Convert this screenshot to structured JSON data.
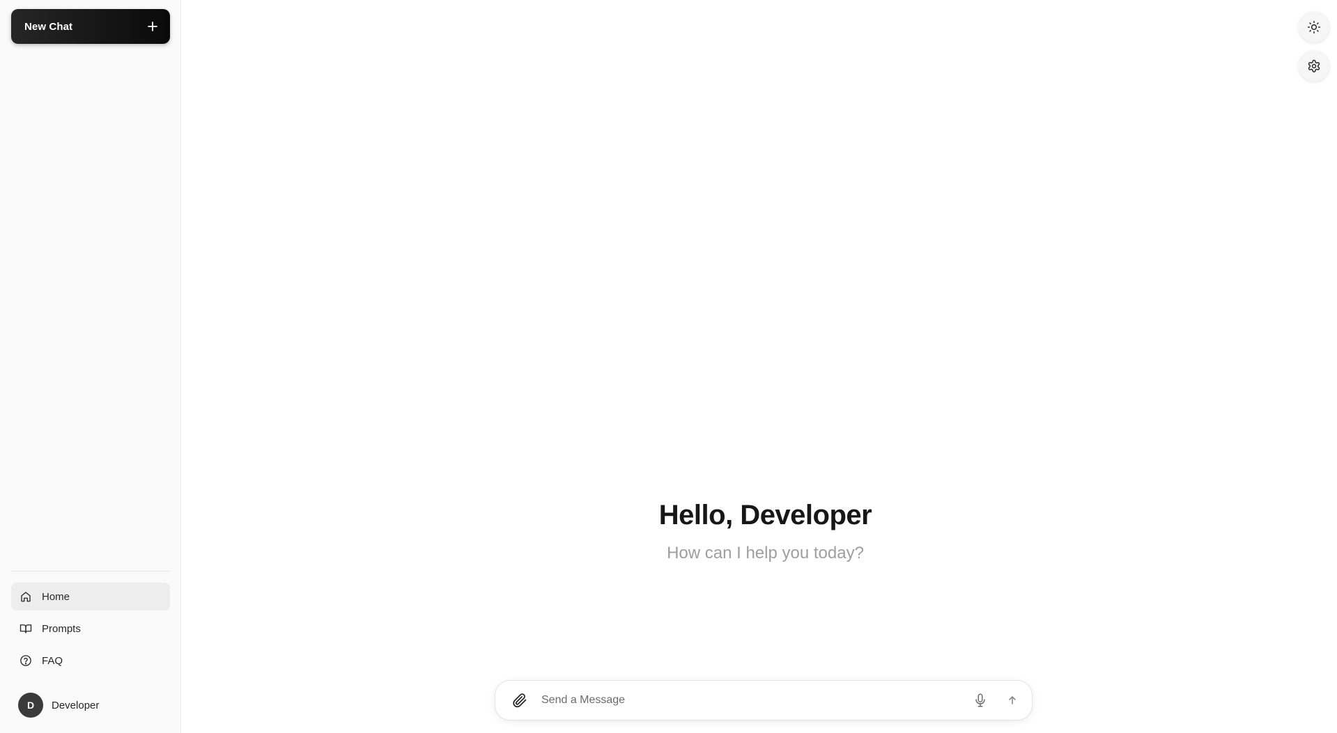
{
  "sidebar": {
    "new_chat_label": "New Chat",
    "new_chat_icon": "plus-icon",
    "nav": [
      {
        "label": "Home",
        "icon": "home-icon",
        "active": true
      },
      {
        "label": "Prompts",
        "icon": "book-icon",
        "active": false
      },
      {
        "label": "FAQ",
        "icon": "help-circle-icon",
        "active": false
      }
    ],
    "user": {
      "initial": "D",
      "name": "Developer"
    }
  },
  "header": {
    "theme_toggle_icon": "sun-icon",
    "settings_icon": "gear-icon"
  },
  "main": {
    "greeting": "Hello, Developer",
    "subtitle": "How can I help you today?"
  },
  "composer": {
    "placeholder": "Send a Message",
    "value": "",
    "attach_icon": "paperclip-icon",
    "mic_icon": "microphone-icon",
    "send_icon": "arrow-up-icon"
  },
  "colors": {
    "sidebar_bg": "#fafafa",
    "new_chat_bg": "#0a0a0a",
    "active_nav_bg": "#ededed",
    "subtitle_text": "#9e9e9e",
    "avatar_bg": "#3a3a3a"
  }
}
